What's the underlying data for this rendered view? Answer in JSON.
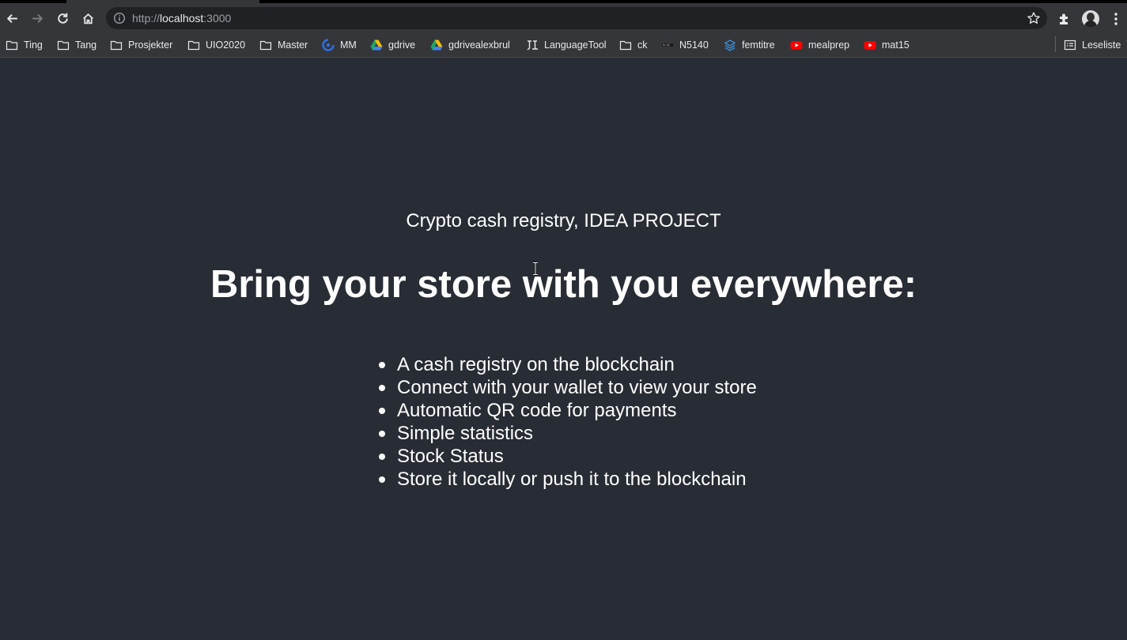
{
  "browser": {
    "url_scheme": "http://",
    "url_host": "localhost",
    "url_port": ":3000",
    "bookmarks": [
      {
        "label": "Ting",
        "icon": "folder-icon"
      },
      {
        "label": "Tang",
        "icon": "folder-icon"
      },
      {
        "label": "Prosjekter",
        "icon": "folder-icon"
      },
      {
        "label": "UIO2020",
        "icon": "folder-icon"
      },
      {
        "label": "Master",
        "icon": "folder-icon"
      },
      {
        "label": "MM",
        "icon": "mm-icon"
      },
      {
        "label": "gdrive",
        "icon": "google-drive-icon"
      },
      {
        "label": "gdrivealexbrul",
        "icon": "google-drive-icon"
      },
      {
        "label": "LanguageTool",
        "icon": "languagetool-icon"
      },
      {
        "label": "ck",
        "icon": "folder-icon"
      },
      {
        "label": "N5140",
        "icon": "uio-icon"
      },
      {
        "label": "femtitre",
        "icon": "stack-icon"
      },
      {
        "label": "mealprep",
        "icon": "youtube-icon"
      },
      {
        "label": "mat15",
        "icon": "youtube-icon"
      }
    ],
    "reading_list_label": "Leseliste"
  },
  "page": {
    "subtitle": "Crypto cash registry, IDEA PROJECT",
    "headline": "Bring your store with you everywhere:",
    "features": [
      "A cash registry on the blockchain",
      "Connect with your wallet to view your store",
      "Automatic QR code for payments",
      "Simple statistics",
      "Stock Status",
      "Store it locally or push it to the blockchain"
    ]
  },
  "colors": {
    "page_background": "#282c34",
    "chrome_background": "#35363a",
    "omnibox_background": "#202124",
    "text": "#ffffff"
  }
}
